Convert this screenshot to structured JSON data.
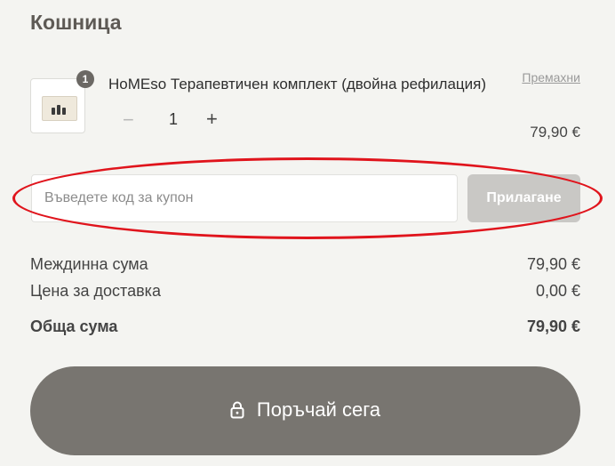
{
  "cart": {
    "title": "Кошница",
    "item": {
      "name": "HoMEso Терапевтичен комплект (двойна рефилация)",
      "quantity_badge": "1",
      "quantity": "1",
      "remove_label": "Премахни",
      "price": "79,90 €",
      "minus_symbol": "−",
      "plus_symbol": "+"
    },
    "coupon": {
      "placeholder": "Въведете код за купон",
      "apply_label": "Прилагане"
    },
    "summary": {
      "subtotal_label": "Междинна сума",
      "subtotal_value": "79,90 €",
      "shipping_label": "Цена за доставка",
      "shipping_value": "0,00 €",
      "total_label": "Обща сума",
      "total_value": "79,90 €"
    },
    "checkout": {
      "label": "Поръчай сега",
      "icon": "lock-icon"
    }
  },
  "colors": {
    "background": "#f4f4f1",
    "checkout_button": "#787570",
    "apply_button": "#c9c8c5",
    "annotation": "#e0141c"
  }
}
